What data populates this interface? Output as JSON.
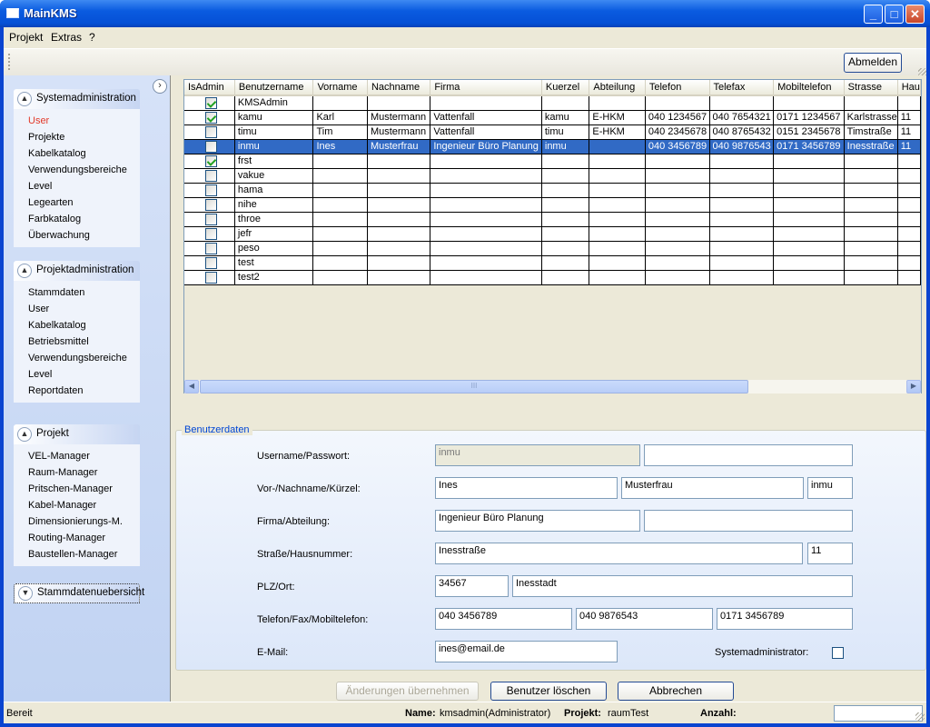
{
  "window": {
    "title": "MainKMS"
  },
  "menu": [
    "Projekt",
    "Extras",
    "?"
  ],
  "toolbar": {
    "logout_label": "Abmelden"
  },
  "sidebar": {
    "groups": [
      {
        "title": "Systemadministration",
        "items": [
          "User",
          "Projekte",
          "Kabelkatalog",
          "Verwendungsbereiche",
          "Level",
          "Legearten",
          "Farbkatalog",
          "Überwachung"
        ],
        "active": "User"
      },
      {
        "title": "Projektadministration",
        "items": [
          "Stammdaten",
          "User",
          "Kabelkatalog",
          "Betriebsmittel",
          "Verwendungsbereiche",
          "Level",
          "Reportdaten"
        ]
      },
      {
        "title": "Projekt",
        "items": [
          "VEL-Manager",
          "Raum-Manager",
          "Pritschen-Manager",
          "Kabel-Manager",
          "Dimensionierungs-M.",
          "Routing-Manager",
          "Baustellen-Manager"
        ]
      },
      {
        "title": "Stammdatenuebersicht",
        "items": []
      }
    ]
  },
  "grid": {
    "columns": [
      "IsAdmin",
      "Benutzername",
      "Vorname",
      "Nachname",
      "Firma",
      "Kuerzel",
      "Abteilung",
      "Telefon",
      "Telefax",
      "Mobiltelefon",
      "Strasse",
      "Hau"
    ],
    "rows": [
      {
        "admin": true,
        "cells": [
          "KMSAdmin",
          "",
          "",
          "",
          "",
          "",
          "",
          "",
          "",
          "",
          ""
        ]
      },
      {
        "admin": true,
        "cells": [
          "kamu",
          "Karl",
          "Mustermann",
          "Vattenfall",
          "kamu",
          "E-HKM",
          "040 1234567",
          "040 7654321",
          "0171 1234567",
          "Karlstrasse",
          "11"
        ]
      },
      {
        "admin": false,
        "cells": [
          "timu",
          "Tim",
          "Mustermann",
          "Vattenfall",
          "timu",
          "E-HKM",
          "040 2345678",
          "040 8765432",
          "0151 2345678",
          "Timstraße",
          "11"
        ]
      },
      {
        "admin": false,
        "selected": true,
        "cells": [
          "inmu",
          "Ines",
          "Musterfrau",
          "Ingenieur Büro Planung",
          "inmu",
          "",
          "040 3456789",
          "040 9876543",
          "0171 3456789",
          "Inesstraße",
          "11"
        ]
      },
      {
        "admin": true,
        "cells": [
          "frst",
          "",
          "",
          "",
          "",
          "",
          "",
          "",
          "",
          "",
          ""
        ]
      },
      {
        "admin": false,
        "cells": [
          "vakue",
          "",
          "",
          "",
          "",
          "",
          "",
          "",
          "",
          "",
          ""
        ]
      },
      {
        "admin": false,
        "cells": [
          "hama",
          "",
          "",
          "",
          "",
          "",
          "",
          "",
          "",
          "",
          ""
        ]
      },
      {
        "admin": false,
        "cells": [
          "nihe",
          "",
          "",
          "",
          "",
          "",
          "",
          "",
          "",
          "",
          ""
        ]
      },
      {
        "admin": false,
        "cells": [
          "throe",
          "",
          "",
          "",
          "",
          "",
          "",
          "",
          "",
          "",
          ""
        ]
      },
      {
        "admin": false,
        "cells": [
          "jefr",
          "",
          "",
          "",
          "",
          "",
          "",
          "",
          "",
          "",
          ""
        ]
      },
      {
        "admin": false,
        "cells": [
          "peso",
          "",
          "",
          "",
          "",
          "",
          "",
          "",
          "",
          "",
          ""
        ]
      },
      {
        "admin": false,
        "cells": [
          "test",
          "",
          "",
          "",
          "",
          "",
          "",
          "",
          "",
          "",
          ""
        ]
      },
      {
        "admin": false,
        "cells": [
          "test2",
          "",
          "",
          "",
          "",
          "",
          "",
          "",
          "",
          "",
          ""
        ]
      }
    ],
    "scroll_grip": "III"
  },
  "form": {
    "title": "Benutzerdaten",
    "labels": {
      "user_pass": "Username/Passwort:",
      "names": "Vor-/Nachname/Kürzel:",
      "company": "Firma/Abteilung:",
      "street": "Straße/Hausnummer:",
      "zip_city": "PLZ/Ort:",
      "phones": "Telefon/Fax/Mobiltelefon:",
      "email": "E-Mail:",
      "sysadmin": "Systemadministrator:"
    },
    "values": {
      "username": "inmu",
      "password": "",
      "firstname": "Ines",
      "lastname": "Musterfrau",
      "short": "inmu",
      "company": "Ingenieur Büro Planung",
      "department": "",
      "street": "Inesstraße",
      "house": "11",
      "zip": "34567",
      "city": "Inesstadt",
      "phone": "040 3456789",
      "fax": "040 9876543",
      "mobile": "0171 3456789",
      "email": "ines@email.de"
    },
    "sysadmin_checked": false
  },
  "actions": {
    "apply": "Änderungen übernehmen",
    "delete": "Benutzer löschen",
    "cancel": "Abbrechen"
  },
  "status": {
    "ready": "Bereit",
    "name_label": "Name:",
    "name_value": "kmsadmin(Administrator)",
    "project_label": "Projekt:",
    "project_value": "raumTest",
    "count_label": "Anzahl:",
    "count_value": ""
  }
}
